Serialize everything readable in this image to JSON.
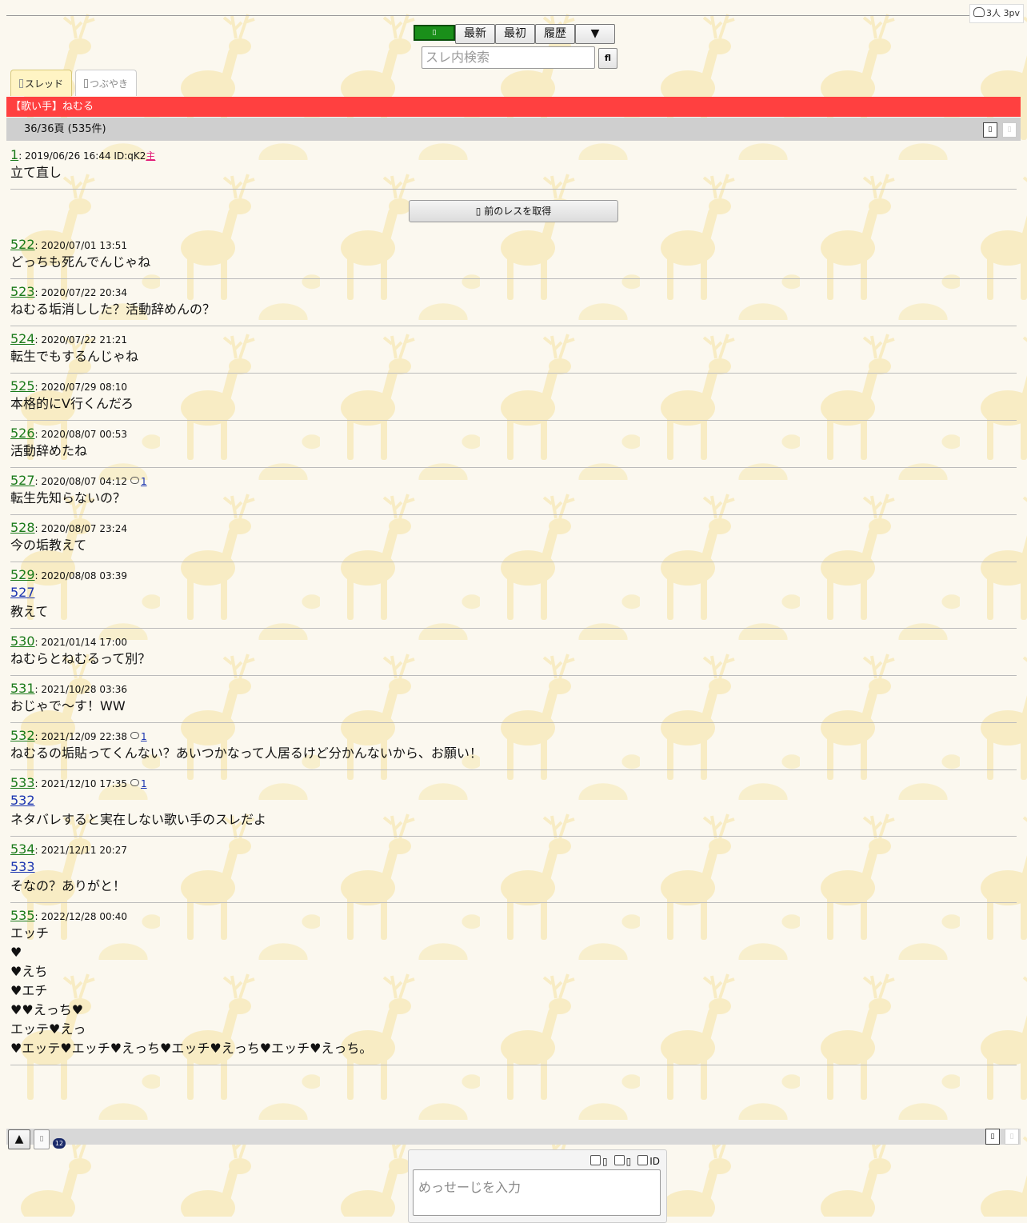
{
  "viewer": {
    "count_label": "3人 3pv",
    "icon": "viewer-icon"
  },
  "nav": {
    "home_label": "",
    "latest_label": "最新",
    "first_label": "最初",
    "history_label": "履歴",
    "more_label": "▼"
  },
  "search": {
    "placeholder": "スレ内検索",
    "button_label": "fl"
  },
  "tabs": [
    {
      "label": "スレッド",
      "active": true
    },
    {
      "label": "つぶやき",
      "active": false
    }
  ],
  "thread": {
    "title": "【歌い手】ねむる"
  },
  "pagination": {
    "page_info": "36/36頁 (535件)"
  },
  "prev_button_label": "前のレスを取得",
  "first_post": {
    "num": "1",
    "date": "2019/06/26 16:44 ID:qK2",
    "owner_mark": "主",
    "body": "立て直し"
  },
  "posts": [
    {
      "num": "522",
      "date": "2020/07/01 13:51",
      "reply_count": "",
      "anchor": "",
      "body": [
        "どっちも死んでんじゃね"
      ]
    },
    {
      "num": "523",
      "date": "2020/07/22 20:34",
      "reply_count": "",
      "anchor": "",
      "body": [
        "ねむる垢消しした？活動辞めんの？"
      ]
    },
    {
      "num": "524",
      "date": "2020/07/22 21:21",
      "reply_count": "",
      "anchor": "",
      "body": [
        "転生でもするんじゃね"
      ]
    },
    {
      "num": "525",
      "date": "2020/07/29 08:10",
      "reply_count": "",
      "anchor": "",
      "body": [
        "本格的にV行くんだろ"
      ]
    },
    {
      "num": "526",
      "date": "2020/08/07 00:53",
      "reply_count": "",
      "anchor": "",
      "body": [
        "活動辞めたね"
      ]
    },
    {
      "num": "527",
      "date": "2020/08/07 04:12",
      "reply_count": "1",
      "anchor": "",
      "body": [
        "転生先知らないの？"
      ]
    },
    {
      "num": "528",
      "date": "2020/08/07 23:24",
      "reply_count": "",
      "anchor": "",
      "body": [
        "今の垢教えて"
      ]
    },
    {
      "num": "529",
      "date": "2020/08/08 03:39",
      "reply_count": "",
      "anchor": "527",
      "body": [
        "教えて"
      ]
    },
    {
      "num": "530",
      "date": "2021/01/14 17:00",
      "reply_count": "",
      "anchor": "",
      "body": [
        "ねむらとねむるって別？"
      ]
    },
    {
      "num": "531",
      "date": "2021/10/28 03:36",
      "reply_count": "",
      "anchor": "",
      "body": [
        "おじゃで〜す！WW"
      ]
    },
    {
      "num": "532",
      "date": "2021/12/09 22:38",
      "reply_count": "1",
      "anchor": "",
      "body": [
        "ねむるの垢貼ってくんない？あいつかなって人居るけど分かんないから、お願い！"
      ]
    },
    {
      "num": "533",
      "date": "2021/12/10 17:35",
      "reply_count": "1",
      "anchor": "532",
      "body": [
        "ネタバレすると実在しない歌い手のスレだよ"
      ]
    },
    {
      "num": "534",
      "date": "2021/12/11 20:27",
      "reply_count": "",
      "anchor": "533",
      "body": [
        "そなの？ありがと！"
      ]
    },
    {
      "num": "535",
      "date": "2022/12/28 00:40",
      "reply_count": "",
      "anchor": "",
      "body": [
        "エッチ",
        "♥",
        "♥えち",
        "♥エチ",
        "♥♥えっち♥",
        "エッテ♥えっ",
        "♥エッテ♥エッチ♥えっち♥エッチ♥えっち♥エッチ♥えっち。"
      ]
    }
  ],
  "bottom": {
    "up_label": "▲",
    "badge_count": "12"
  },
  "compose": {
    "options": [
      "",
      "",
      "ID"
    ],
    "placeholder": "めっせーじを入力"
  },
  "colors": {
    "title_bar": "#ff4040",
    "post_number": "#1a7a1a",
    "anchor_link": "#1a34b0",
    "background": "#fbf8ef",
    "pattern": "#f7e8b0"
  }
}
